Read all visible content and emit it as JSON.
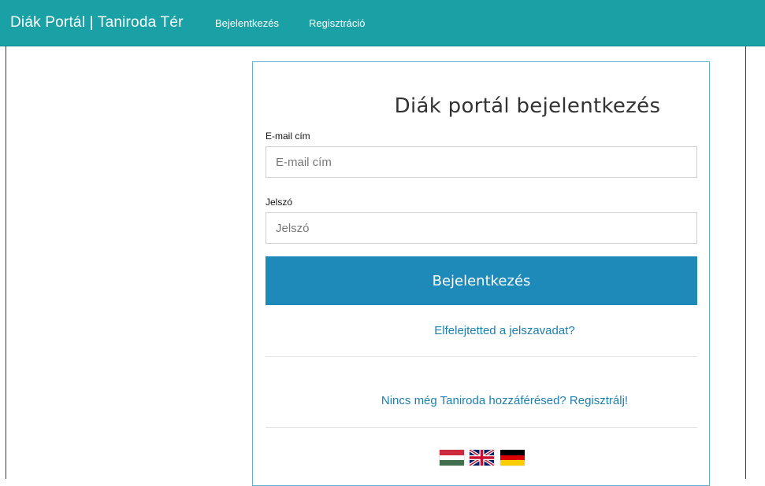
{
  "navbar": {
    "brand": "Diák Portál | Taniroda Tér",
    "links": [
      {
        "label": "Bejelentkezés"
      },
      {
        "label": "Regisztráció"
      }
    ],
    "color": "#1aa1a6"
  },
  "login_form": {
    "title": "Diák portál bejelentkezés",
    "email": {
      "label": "E-mail cím",
      "placeholder": "E-mail cím",
      "value": ""
    },
    "password": {
      "label": "Jelszó",
      "placeholder": "Jelszó",
      "value": ""
    },
    "submit_label": "Bejelentkezés",
    "submit_color": "#1d8ab9",
    "forgot_link": "Elfelejtetted a jelszavadat?",
    "register_link": "Nincs még Taniroda hozzáférésed? Regisztrálj!"
  },
  "languages": [
    {
      "icon": "flag-hungary-icon"
    },
    {
      "icon": "flag-uk-icon"
    },
    {
      "icon": "flag-germany-icon"
    }
  ]
}
